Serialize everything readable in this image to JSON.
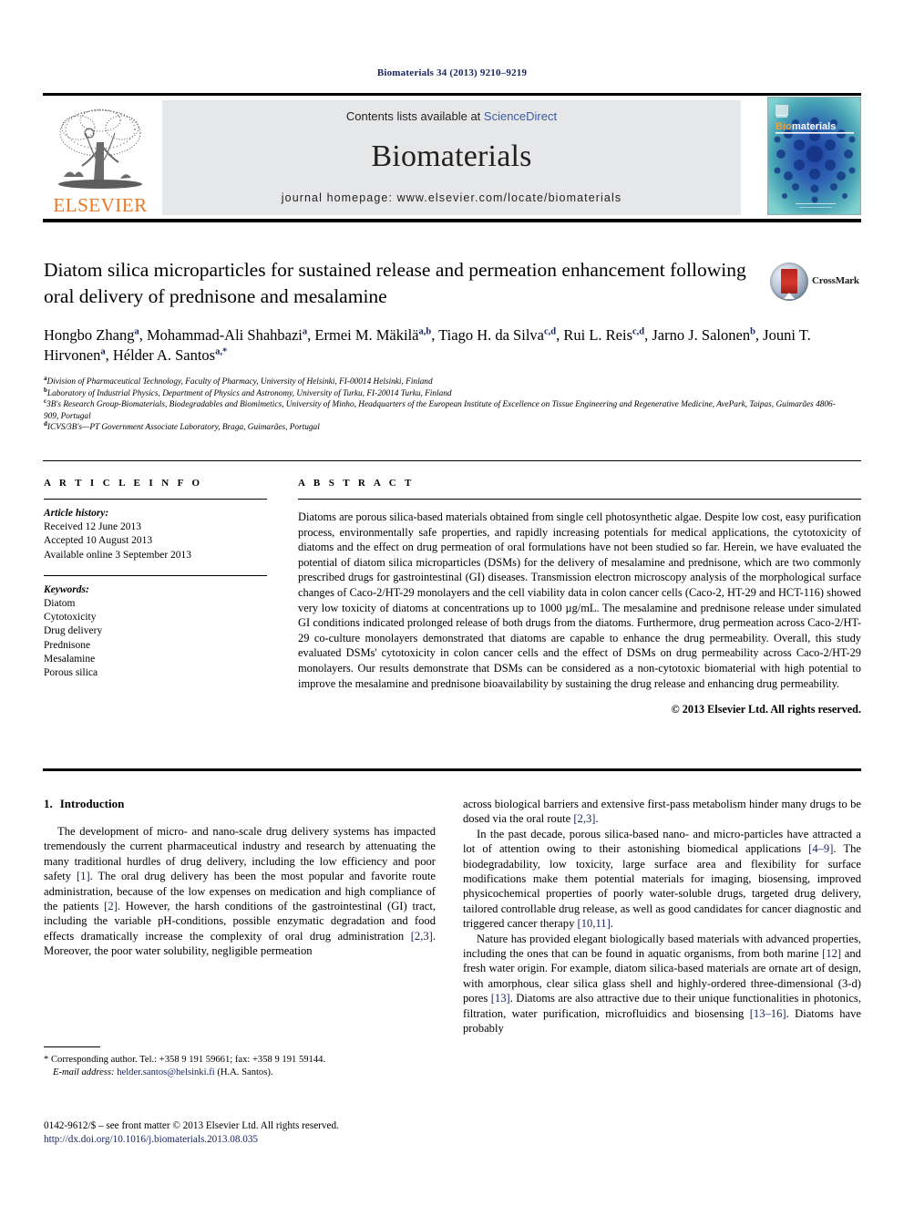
{
  "running_head": "Biomaterials 34 (2013) 9210–9219",
  "journal_header": {
    "contents_prefix": "Contents lists available at ",
    "sciencedirect": "ScienceDirect",
    "journal_name": "Biomaterials",
    "homepage": "journal homepage: www.elsevier.com/locate/biomaterials",
    "publisher_logo_text": "ELSEVIER",
    "cover_title": "Biomaterials",
    "accent_orange": "#E87722",
    "link_blue": "#3b5ba5",
    "band_gray": "#e6e7e8"
  },
  "article": {
    "title": "Diatom silica microparticles for sustained release and permeation enhancement following oral delivery of prednisone and mesalamine",
    "crossmark_label": "CrossMark",
    "authors": [
      {
        "name": "Hongbo Zhang",
        "sup": "a"
      },
      {
        "name": "Mohammad-Ali Shahbazi",
        "sup": "a"
      },
      {
        "name": "Ermei M. Mäkilä",
        "sup": "a,b"
      },
      {
        "name": "Tiago H. da Silva",
        "sup": "c,d"
      },
      {
        "name": "Rui L. Reis",
        "sup": "c,d"
      },
      {
        "name": "Jarno J. Salonen",
        "sup": "b"
      },
      {
        "name": "Jouni T. Hirvonen",
        "sup": "a"
      },
      {
        "name": "Hélder A. Santos",
        "sup": "a,*"
      }
    ],
    "affiliations": [
      {
        "label": "a",
        "text": "Division of Pharmaceutical Technology, Faculty of Pharmacy, University of Helsinki, FI-00014 Helsinki, Finland"
      },
      {
        "label": "b",
        "text": "Laboratory of Industrial Physics, Department of Physics and Astronomy, University of Turku, FI-20014 Turku, Finland"
      },
      {
        "label": "c",
        "text": "3B's Research Group-Biomaterials, Biodegradables and Biomimetics, University of Minho, Headquarters of the European Institute of Excellence on Tissue Engineering and Regenerative Medicine, AvePark, Taipas, Guimarães 4806-909, Portugal"
      },
      {
        "label": "d",
        "text": "ICVS/3B's—PT Government Associate Laboratory, Braga, Guimarães, Portugal"
      }
    ]
  },
  "article_info": {
    "heading": "A R T I C L E   I N F O",
    "history_label": "Article history:",
    "history": [
      "Received 12 June 2013",
      "Accepted 10 August 2013",
      "Available online 3 September 2013"
    ],
    "keywords_label": "Keywords:",
    "keywords": [
      "Diatom",
      "Cytotoxicity",
      "Drug delivery",
      "Prednisone",
      "Mesalamine",
      "Porous silica"
    ]
  },
  "abstract": {
    "heading": "A B S T R A C T",
    "text": "Diatoms are porous silica-based materials obtained from single cell photosynthetic algae. Despite low cost, easy purification process, environmentally safe properties, and rapidly increasing potentials for medical applications, the cytotoxicity of diatoms and the effect on drug permeation of oral formulations have not been studied so far. Herein, we have evaluated the potential of diatom silica microparticles (DSMs) for the delivery of mesalamine and prednisone, which are two commonly prescribed drugs for gastrointestinal (GI) diseases. Transmission electron microscopy analysis of the morphological surface changes of Caco-2/HT-29 monolayers and the cell viability data in colon cancer cells (Caco-2, HT-29 and HCT-116) showed very low toxicity of diatoms at concentrations up to 1000 µg/mL. The mesalamine and prednisone release under simulated GI conditions indicated prolonged release of both drugs from the diatoms. Furthermore, drug permeation across Caco-2/HT-29 co-culture monolayers demonstrated that diatoms are capable to enhance the drug permeability. Overall, this study evaluated DSMs' cytotoxicity in colon cancer cells and the effect of DSMs on drug permeability across Caco-2/HT-29 monolayers. Our results demonstrate that DSMs can be considered as a non-cytotoxic biomaterial with high potential to improve the mesalamine and prednisone bioavailability by sustaining the drug release and enhancing drug permeability.",
    "copyright": "© 2013 Elsevier Ltd. All rights reserved."
  },
  "body": {
    "section_number": "1.",
    "section_title": "Introduction",
    "left_paragraphs": [
      "The development of micro- and nano-scale drug delivery systems has impacted tremendously the current pharmaceutical industry and research by attenuating the many traditional hurdles of drug delivery, including the low efficiency and poor safety [1]. The oral drug delivery has been the most popular and favorite route administration, because of the low expenses on medication and high compliance of the patients [2]. However, the harsh conditions of the gastrointestinal (GI) tract, including the variable pH-conditions, possible enzymatic degradation and food effects dramatically increase the complexity of oral drug administration [2,3]. Moreover, the poor water solubility, negligible permeation"
    ],
    "right_paragraphs": [
      "across biological barriers and extensive first-pass metabolism hinder many drugs to be dosed via the oral route [2,3].",
      "In the past decade, porous silica-based nano- and micro-particles have attracted a lot of attention owing to their astonishing biomedical applications [4–9]. The biodegradability, low toxicity, large surface area and flexibility for surface modifications make them potential materials for imaging, biosensing, improved physicochemical properties of poorly water-soluble drugs, targeted drug delivery, tailored controllable drug release, as well as good candidates for cancer diagnostic and triggered cancer therapy [10,11].",
      "Nature has provided elegant biologically based materials with advanced properties, including the ones that can be found in aquatic organisms, from both marine [12] and fresh water origin. For example, diatom silica-based materials are ornate art of design, with amorphous, clear silica glass shell and highly-ordered three-dimensional (3-d) pores [13]. Diatoms are also attractive due to their unique functionalities in photonics, filtration, water purification, microfluidics and biosensing [13–16]. Diatoms have probably"
    ]
  },
  "footnote": {
    "star": "*",
    "corresponding": "Corresponding author. Tel.: +358 9 191 59661; fax: +358 9 191 59144.",
    "email_label": "E-mail address:",
    "email": "helder.santos@helsinki.fi",
    "email_suffix": "(H.A. Santos)."
  },
  "front_matter": {
    "line1": "0142-9612/$ – see front matter © 2013 Elsevier Ltd. All rights reserved.",
    "doi": "http://dx.doi.org/10.1016/j.biomaterials.2013.08.035"
  }
}
